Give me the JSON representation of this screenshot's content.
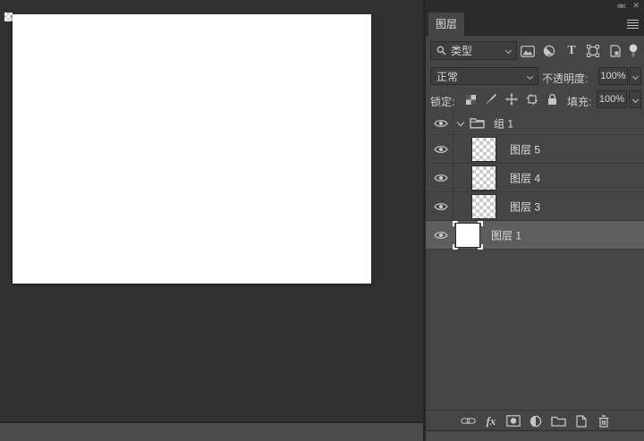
{
  "window": {
    "collapse_label": "««",
    "close_label": "✕"
  },
  "canvas": {
    "background_color": "#ffffff",
    "workspace_color": "#303030"
  },
  "panel": {
    "tab": "图层",
    "filter": {
      "type_label": "类型",
      "icons": [
        "search-icon",
        "pixel-layers-filter-icon",
        "adjustment-layers-filter-icon",
        "type-layers-filter-icon",
        "shape-layers-filter-icon",
        "smart-object-filter-icon",
        "filter-toggle-icon"
      ]
    },
    "blend": {
      "mode": "正常",
      "opacity_label": "不透明度:",
      "opacity_value": "100%"
    },
    "lock": {
      "label": "锁定:",
      "icons": [
        "lock-transparent-pixels-icon",
        "lock-image-pixels-icon",
        "lock-position-icon",
        "lock-artboard-icon",
        "lock-all-icon"
      ],
      "fill_label": "填充:",
      "fill_value": "100%"
    },
    "layers": [
      {
        "name": "组 1",
        "type": "group",
        "expanded": true,
        "visible": true,
        "selected": false
      },
      {
        "name": "图层 5",
        "type": "transparent",
        "in_group": true,
        "visible": true,
        "selected": false
      },
      {
        "name": "图层 4",
        "type": "transparent",
        "in_group": true,
        "visible": true,
        "selected": false
      },
      {
        "name": "图层 3",
        "type": "transparent",
        "in_group": true,
        "visible": true,
        "selected": false
      },
      {
        "name": "图层 1",
        "type": "filled",
        "thumbnail_color": "#ffffff",
        "in_group": false,
        "visible": true,
        "selected": true
      }
    ],
    "bottom_bar_icons": [
      "link-layers-icon",
      "layer-style-fx-icon",
      "add-layer-mask-icon",
      "new-adjustment-layer-icon",
      "new-group-icon",
      "new-layer-icon",
      "delete-layer-icon"
    ],
    "colors": {
      "panel_bg": "#454545",
      "header_bg": "#2b2b2b",
      "selected_row": "#5d5d5d",
      "field_bg": "#3e3e3e"
    }
  }
}
